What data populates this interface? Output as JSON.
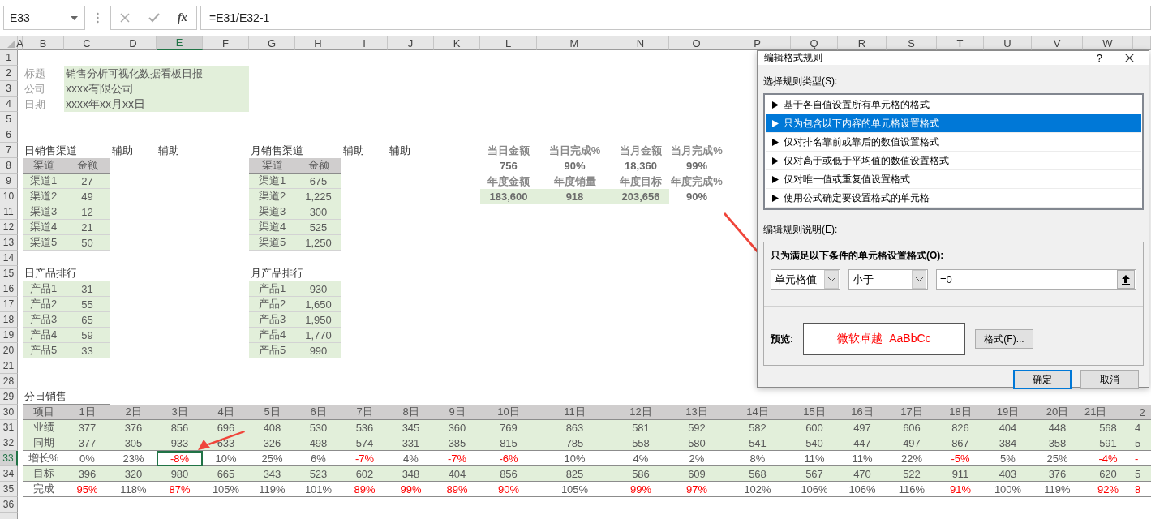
{
  "formula_bar": {
    "name_box": "E33",
    "function_label": "fx",
    "formula": "=E31/E32-1"
  },
  "columns": [
    {
      "label": "A",
      "selected": false
    },
    {
      "label": "B",
      "selected": false
    },
    {
      "label": "C",
      "selected": false
    },
    {
      "label": "D",
      "selected": false
    },
    {
      "label": "E",
      "selected": true
    },
    {
      "label": "F",
      "selected": false
    },
    {
      "label": "G",
      "selected": false
    },
    {
      "label": "H",
      "selected": false
    },
    {
      "label": "I",
      "selected": false
    },
    {
      "label": "J",
      "selected": false
    },
    {
      "label": "K",
      "selected": false
    },
    {
      "label": "L",
      "selected": false
    },
    {
      "label": "M",
      "selected": false
    },
    {
      "label": "N",
      "selected": false
    },
    {
      "label": "O",
      "selected": false
    },
    {
      "label": "P",
      "selected": false
    },
    {
      "label": "Q",
      "selected": false
    },
    {
      "label": "R",
      "selected": false
    },
    {
      "label": "S",
      "selected": false
    },
    {
      "label": "T",
      "selected": false
    },
    {
      "label": "U",
      "selected": false
    },
    {
      "label": "V",
      "selected": false
    },
    {
      "label": "W",
      "selected": false
    }
  ],
  "rows": [
    {
      "label": "1",
      "selected": false
    },
    {
      "label": "2",
      "selected": false
    },
    {
      "label": "3",
      "selected": false
    },
    {
      "label": "4",
      "selected": false
    },
    {
      "label": "5",
      "selected": false
    },
    {
      "label": "6",
      "selected": false
    },
    {
      "label": "7",
      "selected": false
    },
    {
      "label": "8",
      "selected": false
    },
    {
      "label": "9",
      "selected": false
    },
    {
      "label": "10",
      "selected": false
    },
    {
      "label": "11",
      "selected": false
    },
    {
      "label": "12",
      "selected": false
    },
    {
      "label": "13",
      "selected": false
    },
    {
      "label": "14",
      "selected": false
    },
    {
      "label": "15",
      "selected": false
    },
    {
      "label": "16",
      "selected": false
    },
    {
      "label": "17",
      "selected": false
    },
    {
      "label": "18",
      "selected": false
    },
    {
      "label": "19",
      "selected": false
    },
    {
      "label": "20",
      "selected": false
    },
    {
      "label": "21",
      "selected": false
    },
    {
      "label": "28",
      "selected": false
    },
    {
      "label": "29",
      "selected": false
    },
    {
      "label": "30",
      "selected": false
    },
    {
      "label": "31",
      "selected": false
    },
    {
      "label": "32",
      "selected": false
    },
    {
      "label": "33",
      "selected": true
    },
    {
      "label": "34",
      "selected": false
    },
    {
      "label": "35",
      "selected": false
    },
    {
      "label": "36",
      "selected": false
    }
  ],
  "info": [
    {
      "label": "标题",
      "value": "销售分析可视化数据看板日报"
    },
    {
      "label": "公司",
      "value": "xxxx有限公司"
    },
    {
      "label": "日期",
      "value": "xxxx年xx月xx日"
    }
  ],
  "daily_channels": {
    "title": "日销售渠道",
    "helpers": [
      "辅助",
      "辅助"
    ],
    "headers": [
      "渠道",
      "金额"
    ],
    "rows": [
      [
        "渠道1",
        "27"
      ],
      [
        "渠道2",
        "49"
      ],
      [
        "渠道3",
        "12"
      ],
      [
        "渠道4",
        "21"
      ],
      [
        "渠道5",
        "50"
      ]
    ]
  },
  "monthly_channels": {
    "title": "月销售渠道",
    "helpers": [
      "辅助",
      "辅助"
    ],
    "headers": [
      "渠道",
      "金额"
    ],
    "rows": [
      [
        "渠道1",
        "675"
      ],
      [
        "渠道2",
        "1,225"
      ],
      [
        "渠道3",
        "300"
      ],
      [
        "渠道4",
        "525"
      ],
      [
        "渠道5",
        "1,250"
      ]
    ]
  },
  "daily_products": {
    "title": "日产品排行",
    "rows": [
      [
        "产品1",
        "31"
      ],
      [
        "产品2",
        "55"
      ],
      [
        "产品3",
        "65"
      ],
      [
        "产品4",
        "59"
      ],
      [
        "产品5",
        "33"
      ]
    ]
  },
  "monthly_products": {
    "title": "月产品排行",
    "rows": [
      [
        "产品1",
        "930"
      ],
      [
        "产品2",
        "1,650"
      ],
      [
        "产品3",
        "1,950"
      ],
      [
        "产品4",
        "1,770"
      ],
      [
        "产品5",
        "990"
      ]
    ]
  },
  "kpis": [
    {
      "label": "当日金额",
      "value": "756",
      "highlighted": false
    },
    {
      "label": "当日完成%",
      "value": "90%",
      "highlighted": false
    },
    {
      "label": "当月金额",
      "value": "18,360",
      "highlighted": false
    },
    {
      "label": "当月完成%",
      "value": "99%",
      "highlighted": false
    },
    {
      "label": "年度金额",
      "value": "183,600",
      "highlighted": true
    },
    {
      "label": "年度销量",
      "value": "918",
      "highlighted": true
    },
    {
      "label": "年度目标",
      "value": "203,656",
      "highlighted": true
    },
    {
      "label": "年度完成%",
      "value": "90%",
      "highlighted": false
    }
  ],
  "daily_sales": {
    "title": "分日销售",
    "header": [
      "项目",
      "1日",
      "2日",
      "3日",
      "4日",
      "5日",
      "6日",
      "7日",
      "8日",
      "9日",
      "10日",
      "11日",
      "12日",
      "13日",
      "14日",
      "15日",
      "16日",
      "17日",
      "18日",
      "19日",
      "20日",
      "21日",
      "2"
    ],
    "rows": [
      {
        "label": "业绩",
        "highlighted": true,
        "cells": [
          {
            "text": "377",
            "alert": false
          },
          {
            "text": "376",
            "alert": false
          },
          {
            "text": "856",
            "alert": false
          },
          {
            "text": "696",
            "alert": false
          },
          {
            "text": "408",
            "alert": false
          },
          {
            "text": "530",
            "alert": false
          },
          {
            "text": "536",
            "alert": false
          },
          {
            "text": "345",
            "alert": false
          },
          {
            "text": "360",
            "alert": false
          },
          {
            "text": "769",
            "alert": false
          },
          {
            "text": "863",
            "alert": false
          },
          {
            "text": "581",
            "alert": false
          },
          {
            "text": "592",
            "alert": false
          },
          {
            "text": "582",
            "alert": false
          },
          {
            "text": "600",
            "alert": false
          },
          {
            "text": "497",
            "alert": false
          },
          {
            "text": "606",
            "alert": false
          },
          {
            "text": "826",
            "alert": false
          },
          {
            "text": "404",
            "alert": false
          },
          {
            "text": "448",
            "alert": false
          },
          {
            "text": "568",
            "alert": false
          },
          {
            "text": "4",
            "alert": false
          }
        ]
      },
      {
        "label": "同期",
        "highlighted": true,
        "cells": [
          {
            "text": "377",
            "alert": false
          },
          {
            "text": "305",
            "alert": false
          },
          {
            "text": "933",
            "alert": false
          },
          {
            "text": "633",
            "alert": false
          },
          {
            "text": "326",
            "alert": false
          },
          {
            "text": "498",
            "alert": false
          },
          {
            "text": "574",
            "alert": false
          },
          {
            "text": "331",
            "alert": false
          },
          {
            "text": "385",
            "alert": false
          },
          {
            "text": "815",
            "alert": false
          },
          {
            "text": "785",
            "alert": false
          },
          {
            "text": "558",
            "alert": false
          },
          {
            "text": "580",
            "alert": false
          },
          {
            "text": "541",
            "alert": false
          },
          {
            "text": "540",
            "alert": false
          },
          {
            "text": "447",
            "alert": false
          },
          {
            "text": "497",
            "alert": false
          },
          {
            "text": "867",
            "alert": false
          },
          {
            "text": "384",
            "alert": false
          },
          {
            "text": "358",
            "alert": false
          },
          {
            "text": "591",
            "alert": false
          },
          {
            "text": "5",
            "alert": false
          }
        ]
      },
      {
        "label": "增长%",
        "highlighted": false,
        "cells": [
          {
            "text": "0%",
            "alert": false
          },
          {
            "text": "23%",
            "alert": false
          },
          {
            "text": "-8%",
            "alert": true
          },
          {
            "text": "10%",
            "alert": false
          },
          {
            "text": "25%",
            "alert": false
          },
          {
            "text": "6%",
            "alert": false
          },
          {
            "text": "-7%",
            "alert": true
          },
          {
            "text": "4%",
            "alert": false
          },
          {
            "text": "-7%",
            "alert": true
          },
          {
            "text": "-6%",
            "alert": true
          },
          {
            "text": "10%",
            "alert": false
          },
          {
            "text": "4%",
            "alert": false
          },
          {
            "text": "2%",
            "alert": false
          },
          {
            "text": "8%",
            "alert": false
          },
          {
            "text": "11%",
            "alert": false
          },
          {
            "text": "11%",
            "alert": false
          },
          {
            "text": "22%",
            "alert": false
          },
          {
            "text": "-5%",
            "alert": true
          },
          {
            "text": "5%",
            "alert": false
          },
          {
            "text": "25%",
            "alert": false
          },
          {
            "text": "-4%",
            "alert": true
          },
          {
            "text": "-",
            "alert": true
          }
        ]
      },
      {
        "label": "目标",
        "highlighted": true,
        "cells": [
          {
            "text": "396",
            "alert": false
          },
          {
            "text": "320",
            "alert": false
          },
          {
            "text": "980",
            "alert": false
          },
          {
            "text": "665",
            "alert": false
          },
          {
            "text": "343",
            "alert": false
          },
          {
            "text": "523",
            "alert": false
          },
          {
            "text": "602",
            "alert": false
          },
          {
            "text": "348",
            "alert": false
          },
          {
            "text": "404",
            "alert": false
          },
          {
            "text": "856",
            "alert": false
          },
          {
            "text": "825",
            "alert": false
          },
          {
            "text": "586",
            "alert": false
          },
          {
            "text": "609",
            "alert": false
          },
          {
            "text": "568",
            "alert": false
          },
          {
            "text": "567",
            "alert": false
          },
          {
            "text": "470",
            "alert": false
          },
          {
            "text": "522",
            "alert": false
          },
          {
            "text": "911",
            "alert": false
          },
          {
            "text": "403",
            "alert": false
          },
          {
            "text": "376",
            "alert": false
          },
          {
            "text": "620",
            "alert": false
          },
          {
            "text": "5",
            "alert": false
          }
        ]
      },
      {
        "label": "完成",
        "highlighted": false,
        "cells": [
          {
            "text": "95%",
            "alert": true
          },
          {
            "text": "118%",
            "alert": false
          },
          {
            "text": "87%",
            "alert": true
          },
          {
            "text": "105%",
            "alert": false
          },
          {
            "text": "119%",
            "alert": false
          },
          {
            "text": "101%",
            "alert": false
          },
          {
            "text": "89%",
            "alert": true
          },
          {
            "text": "99%",
            "alert": true
          },
          {
            "text": "89%",
            "alert": true
          },
          {
            "text": "90%",
            "alert": true
          },
          {
            "text": "105%",
            "alert": false
          },
          {
            "text": "99%",
            "alert": true
          },
          {
            "text": "97%",
            "alert": true
          },
          {
            "text": "102%",
            "alert": false
          },
          {
            "text": "106%",
            "alert": false
          },
          {
            "text": "106%",
            "alert": false
          },
          {
            "text": "116%",
            "alert": false
          },
          {
            "text": "91%",
            "alert": true
          },
          {
            "text": "100%",
            "alert": false
          },
          {
            "text": "119%",
            "alert": false
          },
          {
            "text": "92%",
            "alert": true
          },
          {
            "text": "8",
            "alert": true
          }
        ]
      }
    ]
  },
  "dialog": {
    "title": "编辑格式规则",
    "help_label": "?",
    "rule_type_label": "选择规则类型(S):",
    "rule_types": [
      {
        "label": "基于各自值设置所有单元格的格式",
        "selected": false
      },
      {
        "label": "只为包含以下内容的单元格设置格式",
        "selected": true
      },
      {
        "label": "仅对排名靠前或靠后的数值设置格式",
        "selected": false
      },
      {
        "label": "仅对高于或低于平均值的数值设置格式",
        "selected": false
      },
      {
        "label": "仅对唯一值或重复值设置格式",
        "selected": false
      },
      {
        "label": "使用公式确定要设置格式的单元格",
        "selected": false
      }
    ],
    "description_label": "编辑规则说明(E):",
    "condition_label": "只为满足以下条件的单元格设置格式(O):",
    "condition": {
      "field": "单元格值",
      "operator": "小于",
      "value": "=0"
    },
    "preview_label": "预览:",
    "preview_text": "微软卓越  AaBbCc",
    "format_button": "格式(F)...",
    "buttons": [
      {
        "label": "确定",
        "default": true
      },
      {
        "label": "取消",
        "default": false
      }
    ]
  }
}
